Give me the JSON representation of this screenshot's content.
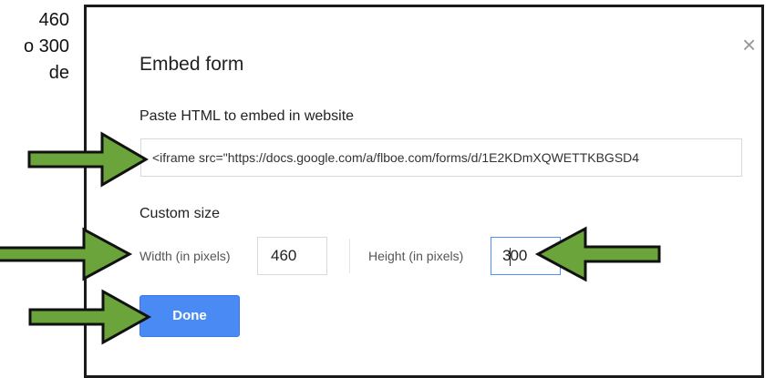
{
  "side_text": {
    "line1": "460",
    "line2": "o 300",
    "line3": "de"
  },
  "dialog": {
    "title": "Embed form",
    "close_glyph": "×",
    "embed_label": "Paste HTML to embed in website",
    "embed_code": "<iframe src=\"https://docs.google.com/a/flboe.com/forms/d/1E2KDmXQWETTKBGSD4",
    "custom_size_label": "Custom size",
    "width_label": "Width (in pixels)",
    "width_value": "460",
    "height_label": "Height (in pixels)",
    "height_value_before_caret": "3",
    "height_value_after_caret": "00",
    "done_label": "Done"
  },
  "colors": {
    "done_button": "#4a8af4",
    "arrow_fill": "#6aa43a",
    "arrow_stroke": "#111111",
    "focus_border": "#4d90fe"
  },
  "icons": {
    "close": "close-icon",
    "arrows": "annotation-arrow-icon"
  }
}
